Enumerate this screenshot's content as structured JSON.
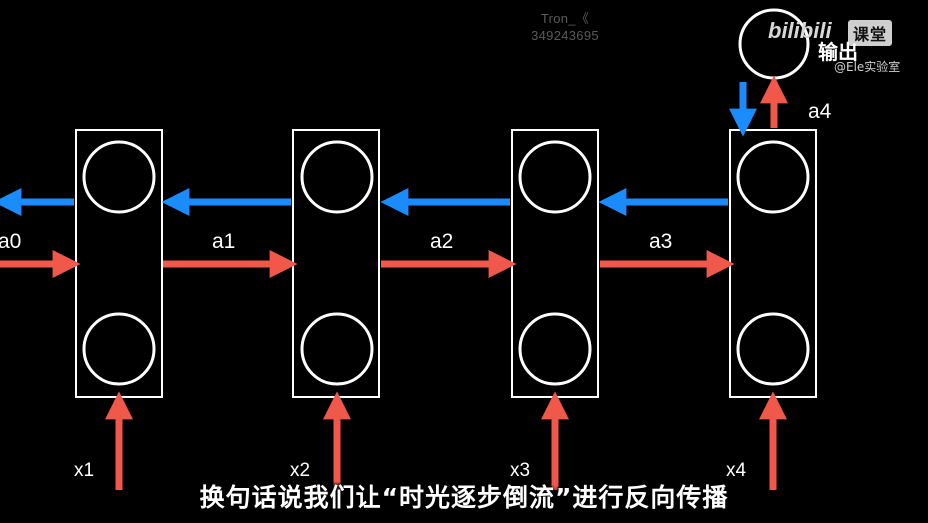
{
  "watermark": {
    "name": "Tron_《",
    "id": "349243695"
  },
  "brand": {
    "logo": "bilibili",
    "course": "课堂",
    "handle": "@Ele实验室"
  },
  "diagram": {
    "output_label": "输出",
    "activation_labels": [
      "a0",
      "a1",
      "a2",
      "a3",
      "a4"
    ],
    "input_labels": [
      "x1",
      "x2",
      "x3",
      "x4"
    ],
    "colors": {
      "forward": "#f0584a",
      "backward": "#1a8cff",
      "stroke": "#ffffff",
      "background": "#000000"
    }
  },
  "subtitle": "换句话说我们让“时光逐步倒流”进行反向传播"
}
